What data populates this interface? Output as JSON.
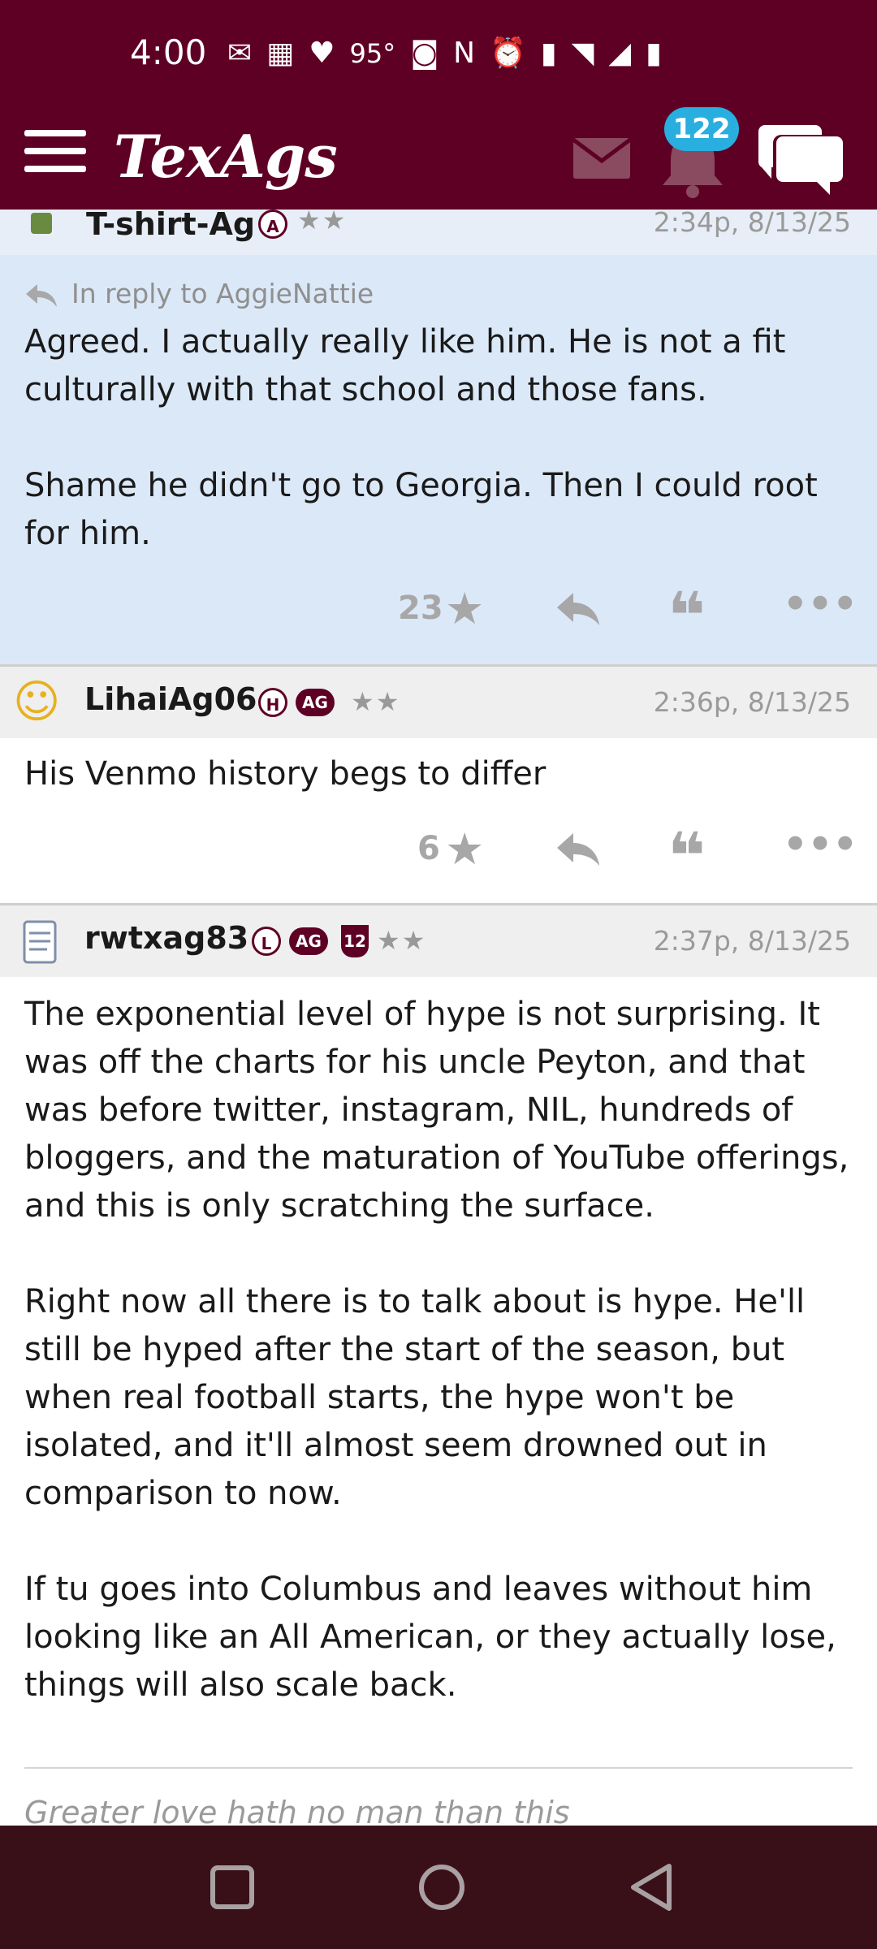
{
  "status_bar": {
    "time": "4:00",
    "temperature": "95°",
    "icons": [
      "mail-icon",
      "qr-icon",
      "heart-icon",
      "camera-icon",
      "nfc-icon",
      "alarm-icon",
      "vibrate-icon",
      "wifi-icon",
      "signal-icon",
      "battery-icon"
    ]
  },
  "header": {
    "logo": "TexAgs",
    "notification_count": "122",
    "colors": {
      "brand": "#5e0024",
      "badge": "#29aee0"
    }
  },
  "posts": [
    {
      "username": "T-shirt-Ag",
      "badges": [
        "A"
      ],
      "stars": "★★",
      "time": "2:34p, 8/13/25",
      "reply_to": "In reply to AggieNattie",
      "body": [
        "Agreed. I actually really like him. He is not a fit culturally with that school and those fans.",
        "Shame he didn't go to Georgia. Then I could root for him."
      ],
      "likes": "23"
    },
    {
      "username": "LihaiAg06",
      "badges": [
        "H",
        "AG"
      ],
      "stars": "★★",
      "time": "2:36p, 8/13/25",
      "body": [
        "His Venmo history begs to differ"
      ],
      "likes": "6"
    },
    {
      "username": "rwtxag83",
      "badges": [
        "L",
        "AG",
        "12"
      ],
      "stars": "★★",
      "time": "2:37p, 8/13/25",
      "body": [
        "The exponential level of hype is not surprising. It was off the charts for his uncle Peyton, and that was before twitter, instagram, NIL, hundreds of bloggers, and the maturation of YouTube offerings, and this is only scratching the surface.",
        "Right now all there is to talk about is hype. He'll still be hyped after the start of the season, but when real football starts, the hype won't be isolated, and it'll almost seem drowned out in comparison to now.",
        "If tu goes into Columbus and leaves without him looking like an All American, or they actually lose, things will also scale back."
      ],
      "signature": "Greater love hath no man than this"
    }
  ]
}
